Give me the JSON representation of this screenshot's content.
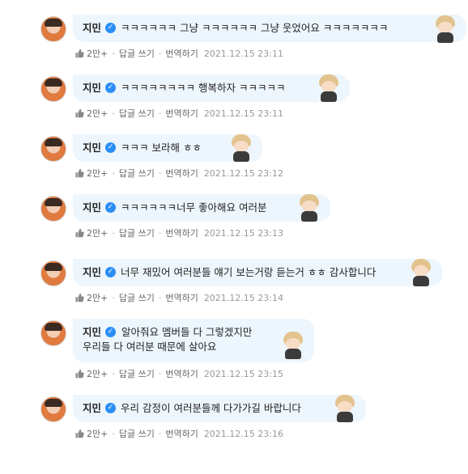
{
  "comments": [
    {
      "name": "지민",
      "text": "ㅋㅋㅋㅋㅋㅋ 그냥 ㅋㅋㅋㅋㅋㅋ 그냥 웃었어요 ㅋㅋㅋㅋㅋㅋㅋ",
      "likes": "2만+",
      "reply": "답글 쓰기",
      "translate": "번역하기",
      "time": "2021.12.15 23:11"
    },
    {
      "name": "지민",
      "text": "ㅋㅋㅋㅋㅋㅋㅋㅋ 행복하자 ㅋㅋㅋㅋㅋ",
      "likes": "2만+",
      "reply": "답글 쓰기",
      "translate": "번역하기",
      "time": "2021.12.15 23:11"
    },
    {
      "name": "지민",
      "text": "ㅋㅋㅋ 보라해 ㅎㅎ",
      "likes": "2만+",
      "reply": "답글 쓰기",
      "translate": "번역하기",
      "time": "2021.12.15 23:12"
    },
    {
      "name": "지민",
      "text": "ㅋㅋㅋㅋㅋㅋ너무 좋아해요 여러분",
      "likes": "2만+",
      "reply": "답글 쓰기",
      "translate": "번역하기",
      "time": "2021.12.15 23:13"
    },
    {
      "name": "지민",
      "text": "너무 재밌어 여러분들 얘기 보는거랑 듣는거 ㅎㅎ 감사합니다",
      "likes": "2만+",
      "reply": "답글 쓰기",
      "translate": "번역하기",
      "time": "2021.12.15 23:14"
    },
    {
      "name": "지민",
      "text": "알아줘요 멤버들 다 그렇겠지만\n우리들 다 여러분 때문에 살아요",
      "likes": "2만+",
      "reply": "답글 쓰기",
      "translate": "번역하기",
      "time": "2021.12.15 23:15"
    },
    {
      "name": "지민",
      "text": "우리 감정이 여러분들께 다가가길 바랍니다",
      "likes": "2만+",
      "reply": "답글 쓰기",
      "translate": "번역하기",
      "time": "2021.12.15 23:16"
    }
  ],
  "icons": {
    "verified": "verified-check-icon",
    "like": "thumbs-up-icon",
    "sticker": "chibi-sticker"
  },
  "colors": {
    "bubble": "#eef6fd",
    "verified": "#2b8ef5"
  }
}
